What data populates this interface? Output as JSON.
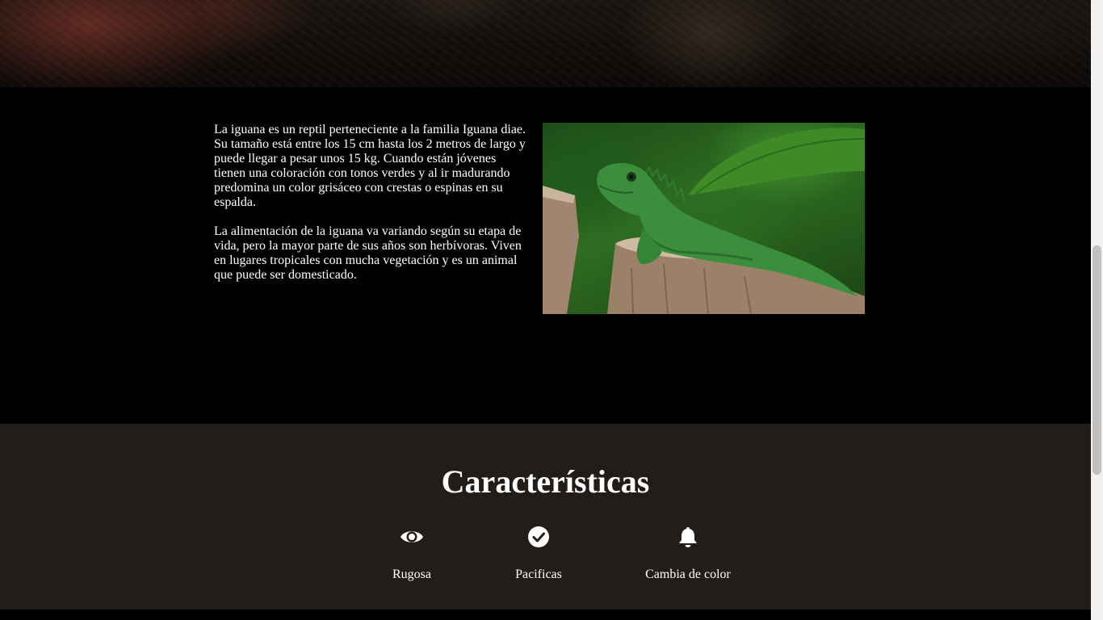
{
  "intro": {
    "paragraphs": [
      "La iguana es un reptil perteneciente a la familia Iguana diae. Su tamaño está entre los 15 cm hasta los 2 metros de largo y puede llegar a pesar unos 15 kg. Cuando están jóvenes tienen una coloración con tonos verdes y al ir madurando predomina un color grisáceo con crestas o espinas en su espalda.",
      "La alimentación de la iguana va variando según su etapa de vida, pero la mayor parte de sus años son herbívoras. Viven en lugares tropicales con mucha vegetación y es un animal que puede ser domesticado."
    ]
  },
  "features": {
    "title": "Características",
    "items": [
      {
        "icon": "eye-icon",
        "label": "Rugosa"
      },
      {
        "icon": "check-circle-icon",
        "label": "Pacificas"
      },
      {
        "icon": "bell-icon",
        "label": "Cambia de color"
      }
    ]
  },
  "colors": {
    "page_background": "#000000",
    "features_background": "#221d19",
    "text": "#ffffff"
  }
}
